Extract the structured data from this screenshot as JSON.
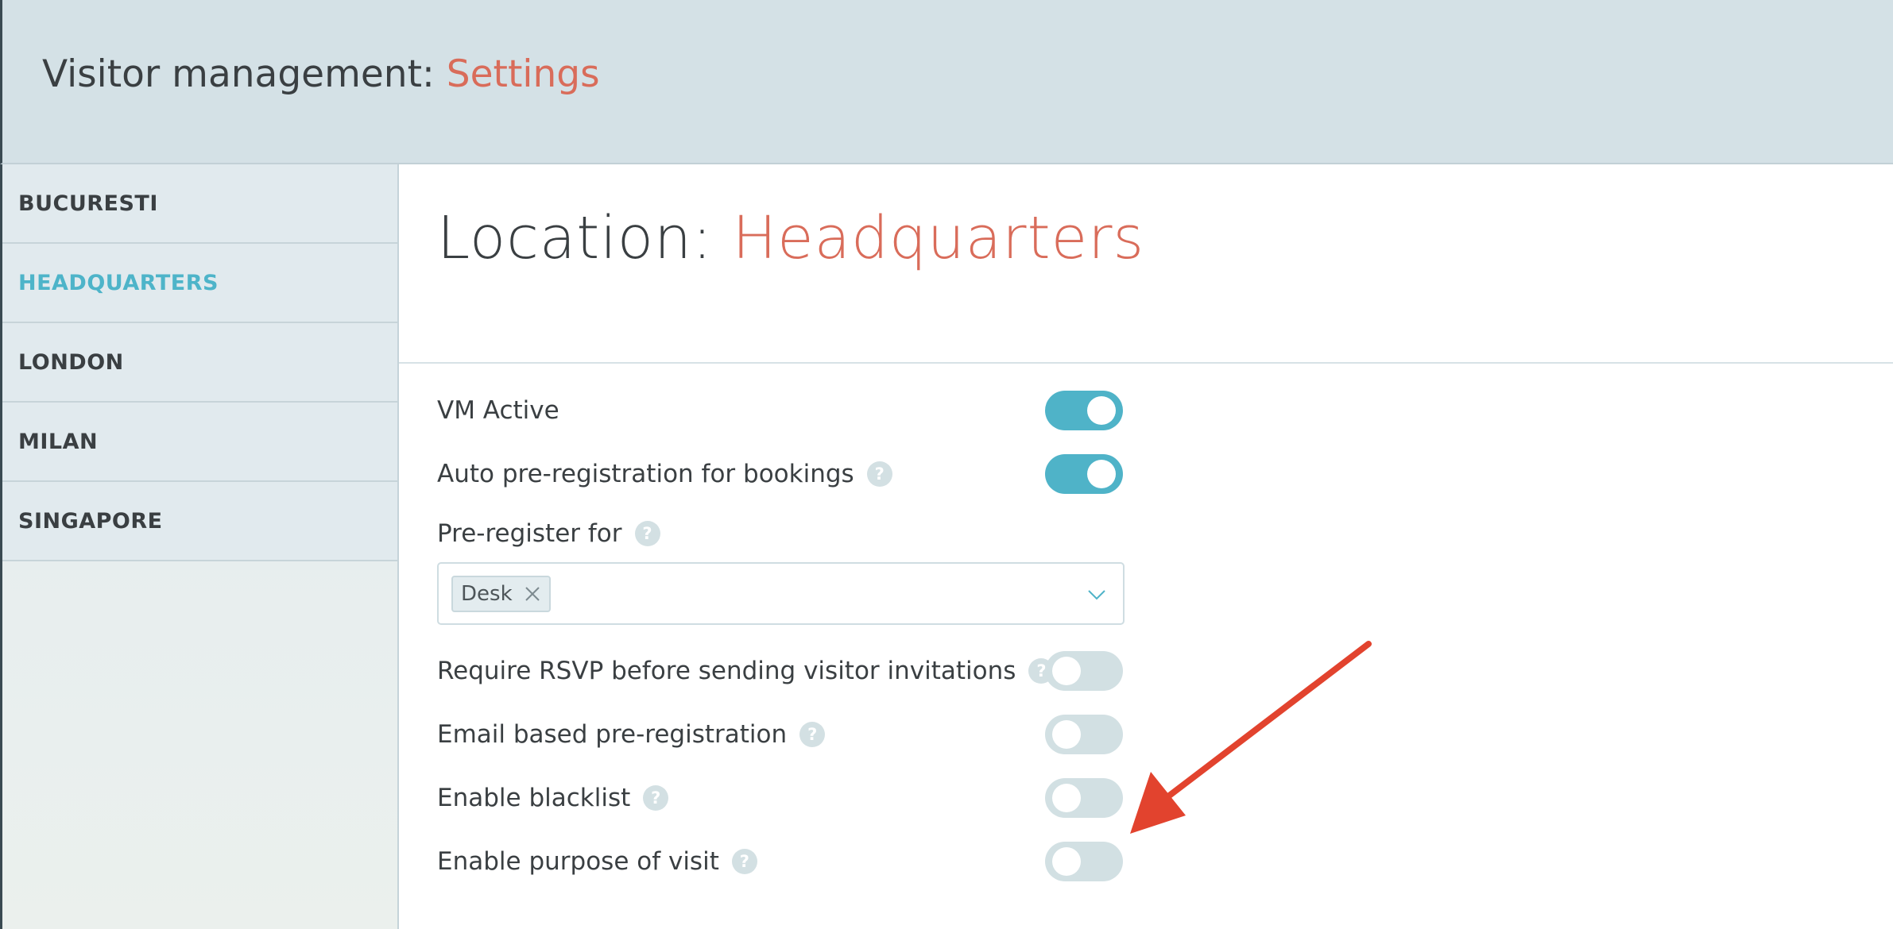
{
  "header": {
    "title_prefix": "Visitor management: ",
    "title_accent": "Settings"
  },
  "sidebar": {
    "items": [
      {
        "label": "BUCURESTI",
        "active": false
      },
      {
        "label": "HEADQUARTERS",
        "active": true
      },
      {
        "label": "LONDON",
        "active": false
      },
      {
        "label": "MILAN",
        "active": false
      },
      {
        "label": "SINGAPORE",
        "active": false
      }
    ]
  },
  "main": {
    "title_prefix": "Location: ",
    "title_accent": "Headquarters",
    "settings": {
      "vm_active": {
        "label": "VM Active",
        "on": true
      },
      "auto_prereg": {
        "label": "Auto pre-registration for bookings",
        "on": true
      },
      "preregister_for": {
        "label": "Pre-register for",
        "selected": [
          "Desk"
        ]
      },
      "require_rsvp": {
        "label": "Require RSVP before sending visitor invitations",
        "on": false
      },
      "email_prereg": {
        "label": "Email based pre-registration",
        "on": false
      },
      "blacklist": {
        "label": "Enable blacklist",
        "on": false
      },
      "purpose_of_visit": {
        "label": "Enable purpose of visit",
        "on": false
      }
    },
    "help_glyph": "?"
  },
  "colors": {
    "accent": "#d96c5a",
    "active_nav": "#4eb4c9",
    "toggle_on": "#4fb3c8",
    "toggle_off": "#d2e0e3",
    "header_bg": "#d4e1e6",
    "annotation_arrow": "#e2432e"
  },
  "icons": {
    "chip_remove": "close-icon",
    "dropdown": "chevron-down-icon",
    "help": "help-icon",
    "annotation": "red-arrow-annotation"
  }
}
